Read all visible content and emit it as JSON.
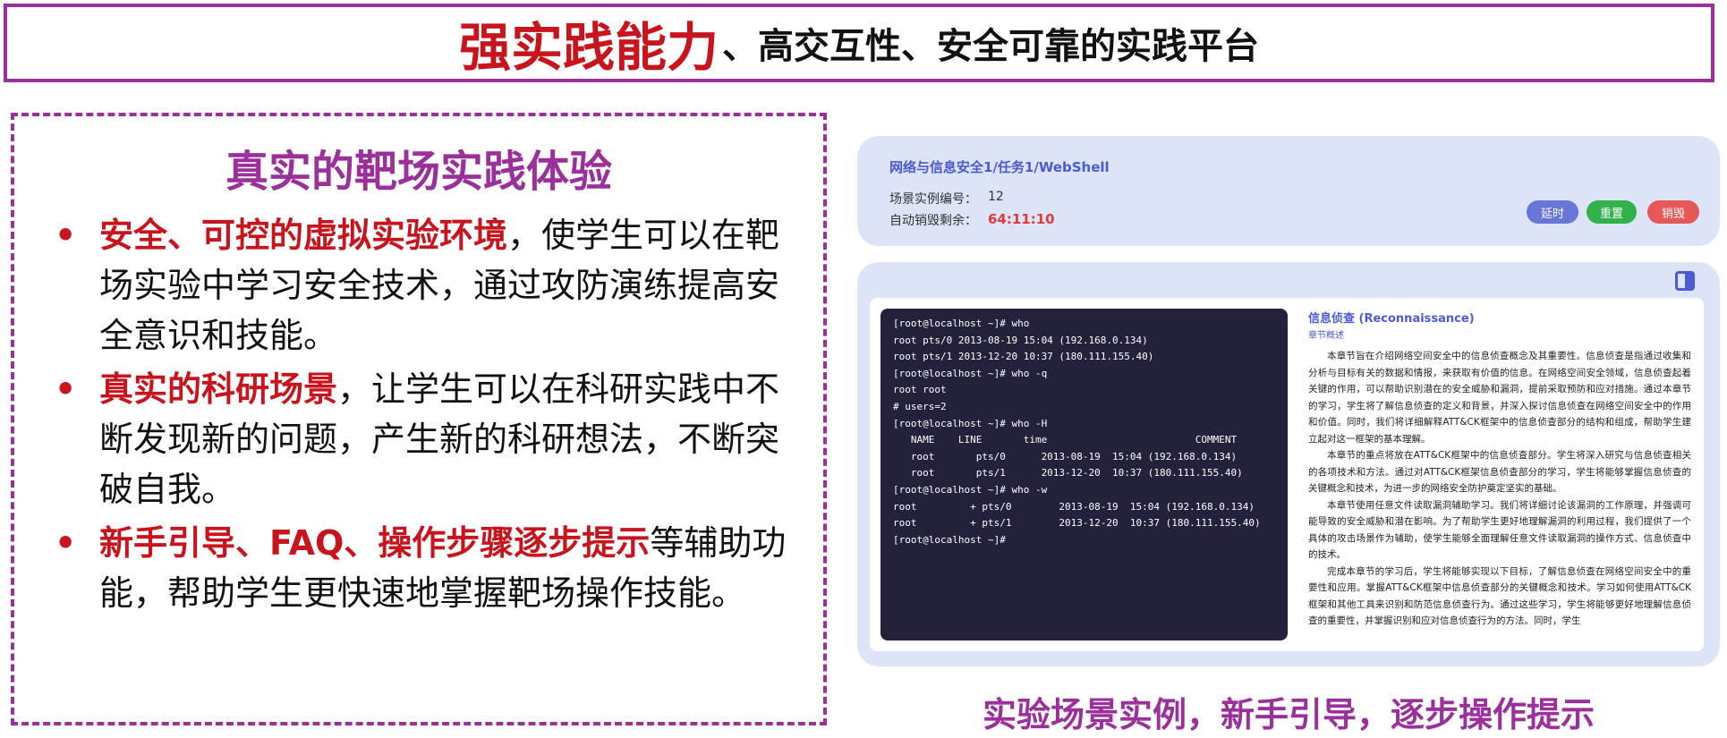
{
  "title": {
    "highlight": "强实践能力",
    "rest": "、高交互性、安全可靠的实践平台"
  },
  "left": {
    "heading": "真实的靶场实践体验",
    "bullets": [
      {
        "highlight": "安全、可控的虚拟实验环境",
        "text": "，使学生可以在靶场实验中学习安全技术，通过攻防演练提高安全意识和技能。"
      },
      {
        "highlight": "真实的科研场景",
        "text": "，让学生可以在科研实践中不断发现新的问题，产生新的科研想法，不断突破自我。"
      },
      {
        "highlight": "新手引导、FAQ、操作步骤逐步提示",
        "text": "等辅助功能，帮助学生更快速地掌握靶场操作技能。"
      }
    ]
  },
  "info_card": {
    "path": "网络与信息安全1/任务1/WebShell",
    "instance_label": "场景实例编号：",
    "instance_value": "12",
    "destroy_label": "自动销毁剩余：",
    "destroy_value": "64:11:10",
    "buttons": {
      "extend": "延时",
      "reset": "重置",
      "destroy": "销毁"
    }
  },
  "terminal_lines": [
    "[root@localhost ~]# who",
    "root pts/0 2013-08-19 15:04 (192.168.0.134)",
    "root pts/1 2013-12-20 10:37 (180.111.155.40)",
    "[root@localhost ~]# who -q",
    "root root",
    "# users=2",
    "[root@localhost ~]# who -H",
    "   NAME    LINE       time                         COMMENT",
    "   root       pts/0      2013-08-19  15:04 (192.168.0.134)",
    "   root       pts/1      2013-12-20  10:37 (180.111.155.40)",
    "[root@localhost ~]# who -w",
    "root         + pts/0        2013-08-19  15:04 (192.168.0.134)",
    "root         + pts/1        2013-12-20  10:37 (180.111.155.40)",
    "[root@localhost ~]#"
  ],
  "doc": {
    "title": "信息侦查 (Reconnaissance)",
    "subtitle": "章节概述",
    "paragraphs": [
      "本章节旨在介绍网络空间安全中的信息侦查概念及其重要性。信息侦查是指通过收集和分析与目标有关的数据和情报，来获取有价值的信息。在网络空间安全领域，信息侦查起着关键的作用，可以帮助识别潜在的安全威胁和漏洞，提前采取预防和应对措施。通过本章节的学习，学生将了解信息侦查的定义和背景，并深入探讨信息侦查在网络空间安全中的作用和价值。同时，我们将详细解释ATT&CK框架中的信息侦查部分的结构和组成，帮助学生建立起对这一框架的基本理解。",
      "本章节的重点将放在ATT&CK框架中的信息侦查部分。学生将深入研究与信息侦查相关的各项技术和方法。通过对ATT&CK框架信息侦查部分的学习，学生将能够掌握信息侦查的关键概念和技术，为进一步的网络安全防护奠定坚实的基础。",
      "本章节使用任意文件读取漏洞辅助学习。我们将详细讨论该漏洞的工作原理，并强调可能导致的安全威胁和潜在影响。为了帮助学生更好地理解漏洞的利用过程，我们提供了一个具体的攻击场景作为辅助，使学生能够全面理解任意文件读取漏洞的操作方式、信息侦查中的技术。",
      "完成本章节的学习后，学生将能够实现以下目标，了解信息侦查在网络空间安全中的重要性和应用。掌握ATT&CK框架中信息侦查部分的关键概念和技术。学习如何使用ATT&CK框架和其他工具来识别和防范信息侦查行为。通过这些学习，学生将能够更好地理解信息侦查的重要性，并掌握识别和应对信息侦查行为的方法。同时，学生"
    ]
  },
  "caption": "实验场景实例，新手引导，逐步操作提示",
  "colors": {
    "accent_red": "#c8141c",
    "accent_purple": "#9b2f9b",
    "card_bg": "#dde4f8",
    "link_blue": "#4b5bd1"
  }
}
